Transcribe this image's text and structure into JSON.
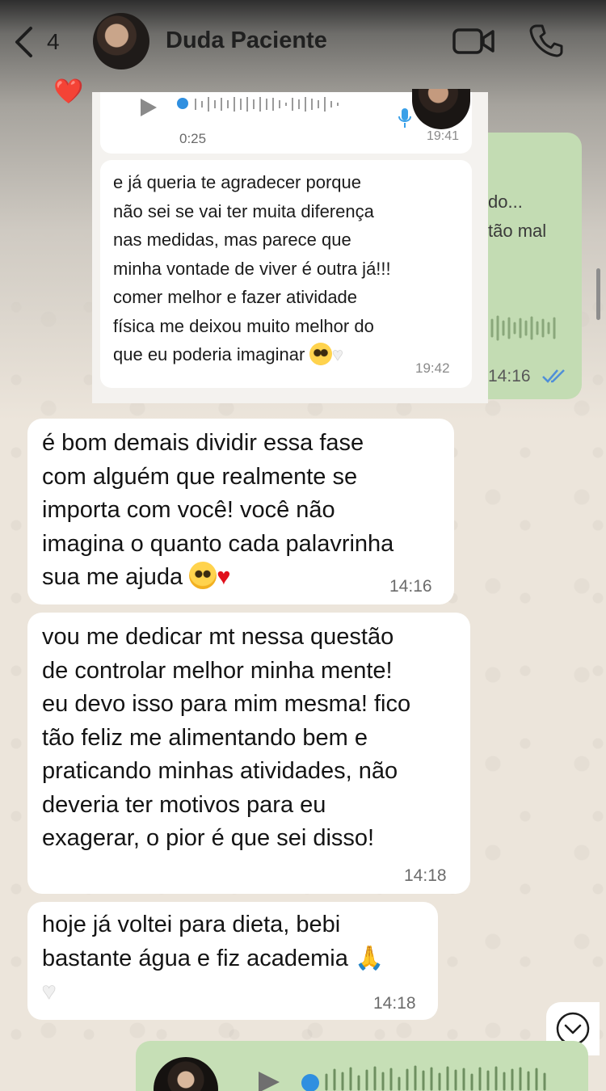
{
  "header": {
    "back_count": "4",
    "contact_name": "Duda Paciente"
  },
  "reaction": {
    "emoji": "❤️"
  },
  "outgoing_partial": {
    "text_line1": "do...",
    "text_line2": "tão mal",
    "time": "14:16"
  },
  "screenshot": {
    "audio": {
      "duration": "0:25",
      "time": "19:41"
    },
    "message": {
      "lines": [
        "e já queria te agradecer porque",
        "não sei se vai ter muita diferença",
        "nas medidas, mas parece que",
        "minha vontade de viver é outra já!!!",
        "comer melhor e fazer atividade",
        "física me deixou muito melhor do",
        "que eu poderia imaginar"
      ],
      "time": "19:42"
    }
  },
  "messages": [
    {
      "lines": [
        "é bom demais dividir essa fase",
        "com alguém que realmente se",
        "importa com você! você não",
        "imagina o quanto cada palavrinha",
        "sua me ajuda"
      ],
      "emoji_heart": "❤️",
      "time": "14:16"
    },
    {
      "lines": [
        "vou me dedicar mt nessa questão",
        "de controlar melhor minha mente!",
        "eu devo isso para mim mesma! fico",
        "tão feliz me alimentando bem e",
        "praticando minhas atividades, não",
        "deveria ter motivos para eu",
        "exagerar, o pior é que sei disso!"
      ],
      "time": "14:18"
    },
    {
      "lines": [
        "hoje já voltei para dieta, bebi",
        "bastante água e fiz academia"
      ],
      "emoji_pray": "🙏",
      "emoji_white_heart": "🤍",
      "time": "14:18"
    }
  ],
  "colors": {
    "incoming_bubble": "#ffffff",
    "outgoing_bubble": "#c3dcb3",
    "ticks": "#4f8fd8"
  },
  "icons": [
    "chevron-left-icon",
    "video-call-icon",
    "phone-icon",
    "play-icon",
    "mic-icon",
    "chevron-down-icon",
    "read-ticks-icon"
  ]
}
